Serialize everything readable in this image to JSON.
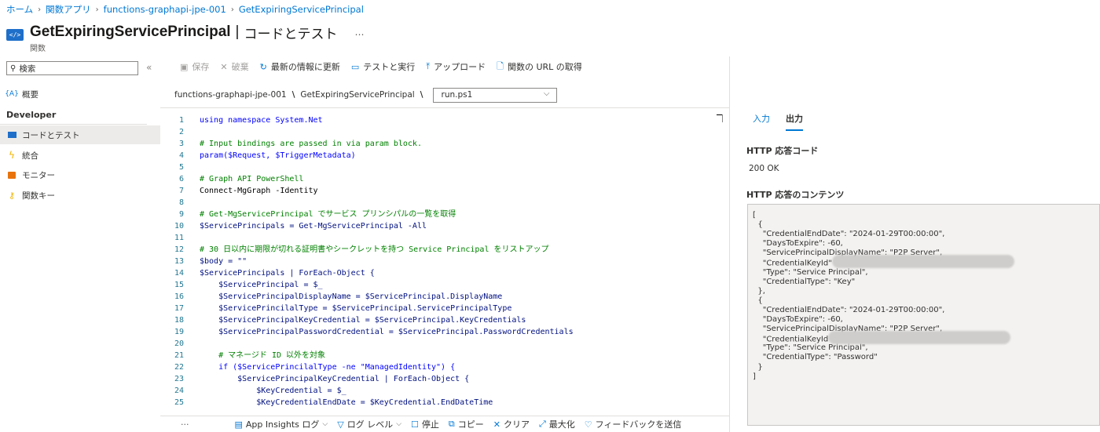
{
  "breadcrumb": [
    "ホーム",
    "関数アプリ",
    "functions-graphapi-jpe-001",
    "GetExpiringServicePrincipal"
  ],
  "header": {
    "title": "GetExpiringServicePrincipal",
    "separator": "|",
    "subtitle": "コードとテスト",
    "type_label": "関数",
    "more": "…"
  },
  "sidebar": {
    "search_placeholder": "検索",
    "collapse": "«",
    "overview": "概要",
    "section": "Developer",
    "items": [
      {
        "label": "コードとテスト",
        "icon": "code-icon"
      },
      {
        "label": "統合",
        "icon": "lightning-icon"
      },
      {
        "label": "モニター",
        "icon": "monitor-icon"
      },
      {
        "label": "関数キー",
        "icon": "key-icon"
      }
    ]
  },
  "toolbar": {
    "save": "保存",
    "discard": "破棄",
    "refresh": "最新の情報に更新",
    "test_run": "テストと実行",
    "upload": "アップロード",
    "get_url": "関数の URL の取得"
  },
  "path": {
    "app": "functions-graphapi-jpe-001",
    "sep": "\\",
    "function": "GetExpiringServicePrincipal",
    "file": "run.ps1"
  },
  "code_lines": [
    {
      "n": "1",
      "t": "using namespace System.Net"
    },
    {
      "n": "2",
      "t": ""
    },
    {
      "n": "3",
      "t": "# Input bindings are passed in via param block."
    },
    {
      "n": "4",
      "t": "param($Request, $TriggerMetadata)"
    },
    {
      "n": "5",
      "t": ""
    },
    {
      "n": "6",
      "t": "# Graph API PowerShell"
    },
    {
      "n": "7",
      "t": "Connect-MgGraph -Identity"
    },
    {
      "n": "8",
      "t": ""
    },
    {
      "n": "9",
      "t": "# Get-MgServicePrincipal でサービス プリンシパルの一覧を取得"
    },
    {
      "n": "10",
      "t": "$ServicePrincipals = Get-MgServicePrincipal -All"
    },
    {
      "n": "11",
      "t": ""
    },
    {
      "n": "12",
      "t": "# 30 日以内に期限が切れる証明書やシークレットを持つ Service Principal をリストアップ"
    },
    {
      "n": "13",
      "t": "$body = \"\""
    },
    {
      "n": "14",
      "t": "$ServicePrincipals | ForEach-Object {"
    },
    {
      "n": "15",
      "t": "    $ServicePrincipal = $_"
    },
    {
      "n": "16",
      "t": "    $ServicePrincipalDisplayName = $ServicePrincipal.DisplayName"
    },
    {
      "n": "17",
      "t": "    $ServicePrincilalType = $ServicePrincipal.ServicePrincipalType"
    },
    {
      "n": "18",
      "t": "    $ServicePrincipalKeyCredential = $ServicePrincipal.KeyCredentials"
    },
    {
      "n": "19",
      "t": "    $ServicePrincipalPasswordCredential = $ServicePrincipal.PasswordCredentials"
    },
    {
      "n": "20",
      "t": ""
    },
    {
      "n": "21",
      "t": "    # マネージド ID 以外を対象"
    },
    {
      "n": "22",
      "t": "    if ($ServicePrincilalType -ne \"ManagedIdentity\") {"
    },
    {
      "n": "23",
      "t": "        $ServicePrincipalKeyCredential | ForEach-Object {"
    },
    {
      "n": "24",
      "t": "            $KeyCredential = $_"
    },
    {
      "n": "25",
      "t": "            $KeyCredentialEndDate = $KeyCredential.EndDateTime"
    }
  ],
  "logbar": {
    "more": "···",
    "insights": "App Insights ログ",
    "level": "ログ レベル",
    "stop": "停止",
    "copy": "コピー",
    "clear": "クリア",
    "maximize": "最大化",
    "feedback": "フィードバックを送信"
  },
  "output": {
    "tab_input": "入力",
    "tab_output": "出力",
    "status_label": "HTTP 応答コード",
    "status_value": "200 OK",
    "content_label": "HTTP 応答のコンテンツ",
    "lines": [
      "[",
      "  {",
      "    \"CredentialEndDate\": \"2024-01-29T00:00:00\",",
      "    \"DaysToExpire\": -60,",
      "    \"ServicePrincipalDisplayName\": \"P2P Server\",",
      "    \"CredentialKeyId\"",
      "    \"Type\": \"Service Principal\",",
      "    \"CredentialType\": \"Key\"",
      "  },",
      "  {",
      "    \"CredentialEndDate\": \"2024-01-29T00:00:00\",",
      "    \"DaysToExpire\": -60,",
      "    \"ServicePrincipalDisplayName\": \"P2P Server\",",
      "    \"CredentialKeyId",
      "    \"Type\": \"Service Principal\",",
      "    \"CredentialType\": \"Password\"",
      "  }",
      "]"
    ]
  }
}
